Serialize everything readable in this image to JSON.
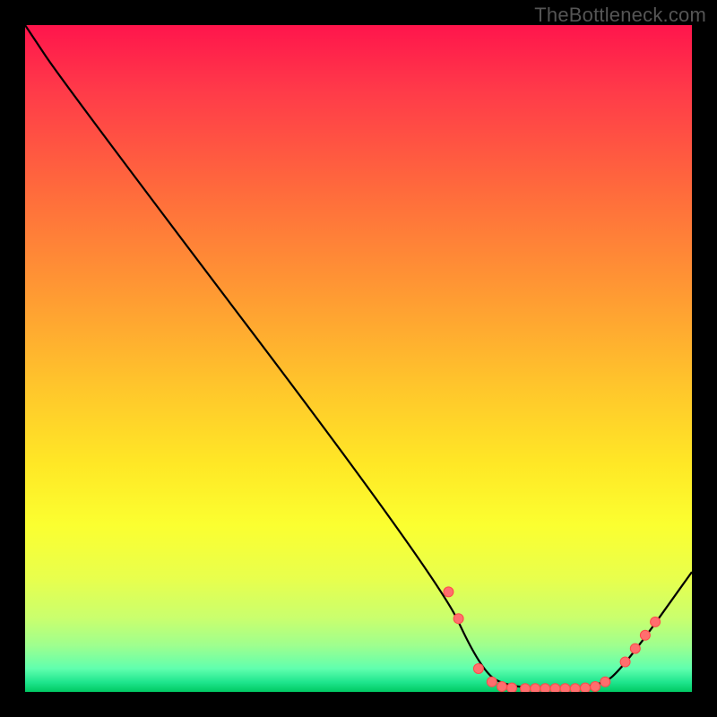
{
  "watermark": "TheBottleneck.com",
  "colors": {
    "background": "#000000",
    "line": "#000000",
    "marker_fill": "#ff6e6e",
    "marker_stroke": "#ff4a4a"
  },
  "chart_data": {
    "type": "line",
    "title": "",
    "xlabel": "",
    "ylabel": "",
    "xlim": [
      0,
      100
    ],
    "ylim": [
      0,
      100
    ],
    "grid": false,
    "line_points": [
      {
        "x": 0,
        "y": 100
      },
      {
        "x": 6,
        "y": 91
      },
      {
        "x": 62,
        "y": 17
      },
      {
        "x": 68,
        "y": 4
      },
      {
        "x": 72,
        "y": 0.5
      },
      {
        "x": 86,
        "y": 0.5
      },
      {
        "x": 90,
        "y": 4
      },
      {
        "x": 100,
        "y": 18
      }
    ],
    "markers": [
      {
        "x": 63.5,
        "y": 15
      },
      {
        "x": 65,
        "y": 11
      },
      {
        "x": 68,
        "y": 3.5
      },
      {
        "x": 70,
        "y": 1.5
      },
      {
        "x": 71.5,
        "y": 0.8
      },
      {
        "x": 73,
        "y": 0.6
      },
      {
        "x": 75,
        "y": 0.5
      },
      {
        "x": 76.5,
        "y": 0.5
      },
      {
        "x": 78,
        "y": 0.5
      },
      {
        "x": 79.5,
        "y": 0.5
      },
      {
        "x": 81,
        "y": 0.5
      },
      {
        "x": 82.5,
        "y": 0.5
      },
      {
        "x": 84,
        "y": 0.6
      },
      {
        "x": 85.5,
        "y": 0.8
      },
      {
        "x": 87,
        "y": 1.5
      },
      {
        "x": 90,
        "y": 4.5
      },
      {
        "x": 91.5,
        "y": 6.5
      },
      {
        "x": 93,
        "y": 8.5
      },
      {
        "x": 94.5,
        "y": 10.5
      }
    ]
  }
}
